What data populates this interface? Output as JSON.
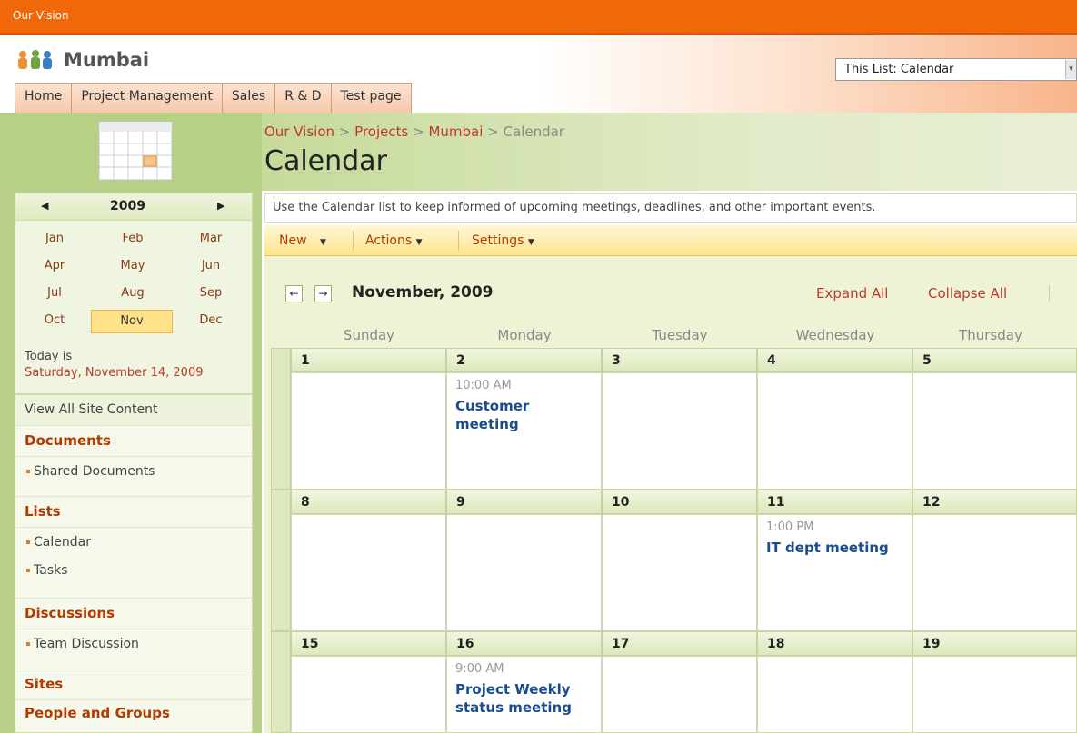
{
  "topbar": {
    "title": "Our Vision"
  },
  "header": {
    "site_title": "Mumbai",
    "search_scope": "This List: Calendar",
    "tabs": [
      "Home",
      "Project Management",
      "Sales",
      "R & D",
      "Test page"
    ]
  },
  "breadcrumb": {
    "parts": [
      "Our Vision",
      "Projects",
      "Mumbai"
    ],
    "current": "Calendar",
    "separator": ">"
  },
  "page": {
    "title": "Calendar",
    "description": "Use the Calendar list to keep informed of upcoming meetings, deadlines, and other important events."
  },
  "toolbar": {
    "new": "New",
    "actions": "Actions",
    "settings": "Settings"
  },
  "date_navigator": {
    "year": "2009",
    "months": [
      "Jan",
      "Feb",
      "Mar",
      "Apr",
      "May",
      "Jun",
      "Jul",
      "Aug",
      "Sep",
      "Oct",
      "Nov",
      "Dec"
    ],
    "selected_month": "Nov",
    "today_label": "Today is",
    "today_value": "Saturday, November 14, 2009"
  },
  "quicklaunch": {
    "view_all": "View All Site Content",
    "documents": "Documents",
    "shared_documents": "Shared Documents",
    "lists": "Lists",
    "calendar": "Calendar",
    "tasks": "Tasks",
    "discussions": "Discussions",
    "team_discussion": "Team Discussion",
    "sites": "Sites",
    "people_and_groups": "People and Groups"
  },
  "calendar": {
    "month_title": "November, 2009",
    "expand_all": "Expand All",
    "collapse_all": "Collapse All",
    "day_names": [
      "Sunday",
      "Monday",
      "Tuesday",
      "Wednesday",
      "Thursday"
    ],
    "weeks": [
      [
        "1",
        "2",
        "3",
        "4",
        "5"
      ],
      [
        "8",
        "9",
        "10",
        "11",
        "12"
      ],
      [
        "15",
        "16",
        "17",
        "18",
        "19"
      ]
    ],
    "events": [
      {
        "time": "10:00 AM",
        "title": "Customer meeting"
      },
      {
        "time": "1:00 PM",
        "title": "IT dept meeting"
      },
      {
        "time": "9:00 AM",
        "title": "Project Weekly status meeting"
      }
    ]
  },
  "colors": {
    "topbar": "#f0680a",
    "accent_link": "#c0392b",
    "event_title": "#1a4d8c",
    "sidebar_green": "#b9ce8a",
    "toolbar_yellow": "#fde48c"
  }
}
